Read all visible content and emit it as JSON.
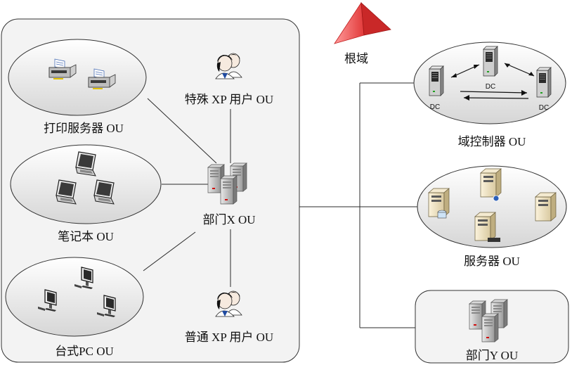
{
  "root_domain": {
    "label": "根域"
  },
  "department_x": {
    "label": "部门X OU",
    "children": {
      "print_servers": "打印服务器 OU",
      "laptops": "笔记本 OU",
      "desktops": "台式PC OU",
      "special_xp_users": "特殊 XP 用户 OU",
      "normal_xp_users": "普通 XP 用户 OU"
    }
  },
  "domain_controllers": {
    "label": "域控制器 OU",
    "dc_label": "DC"
  },
  "servers": {
    "label": "服务器 OU"
  },
  "department_y": {
    "label": "部门Y OU"
  }
}
